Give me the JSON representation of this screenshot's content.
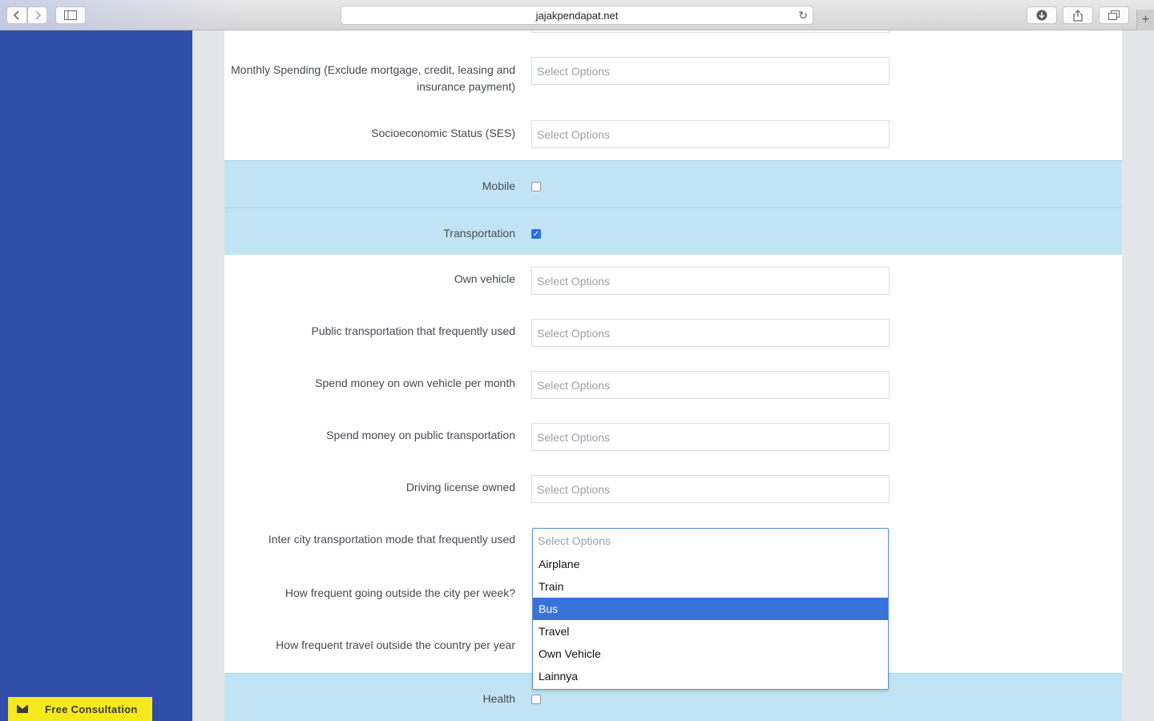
{
  "browser": {
    "url": "jajakpendapat.net"
  },
  "sidebar": {
    "consult_label": "Free Consultation"
  },
  "form": {
    "placeholder": "Select Options",
    "monthly_spending_label": "Monthly Spending (Exclude mortgage, credit, leasing and insurance payment)",
    "ses_label": "Socioeconomic Status (SES)",
    "mobile_label": "Mobile",
    "mobile_checked": false,
    "transportation_label": "Transportation",
    "transportation_checked": true,
    "own_vehicle_label": "Own vehicle",
    "public_transport_label": "Public transportation that frequently used",
    "spend_own_vehicle_label": "Spend money on own vehicle per month",
    "spend_public_label": "Spend money on public transportation",
    "driving_license_label": "Driving license owned",
    "intercity_label": "Inter city transportation mode that frequently used",
    "outside_city_label": "How frequent going outside the city per week?",
    "outside_country_label": "How frequent travel outside the country per year",
    "health_label": "Health",
    "health_checked": false
  },
  "dropdown": {
    "placeholder": "Select Options",
    "options": [
      "Airplane",
      "Train",
      "Bus",
      "Travel",
      "Own Vehicle",
      "Lainnya"
    ],
    "highlighted": "Bus"
  }
}
